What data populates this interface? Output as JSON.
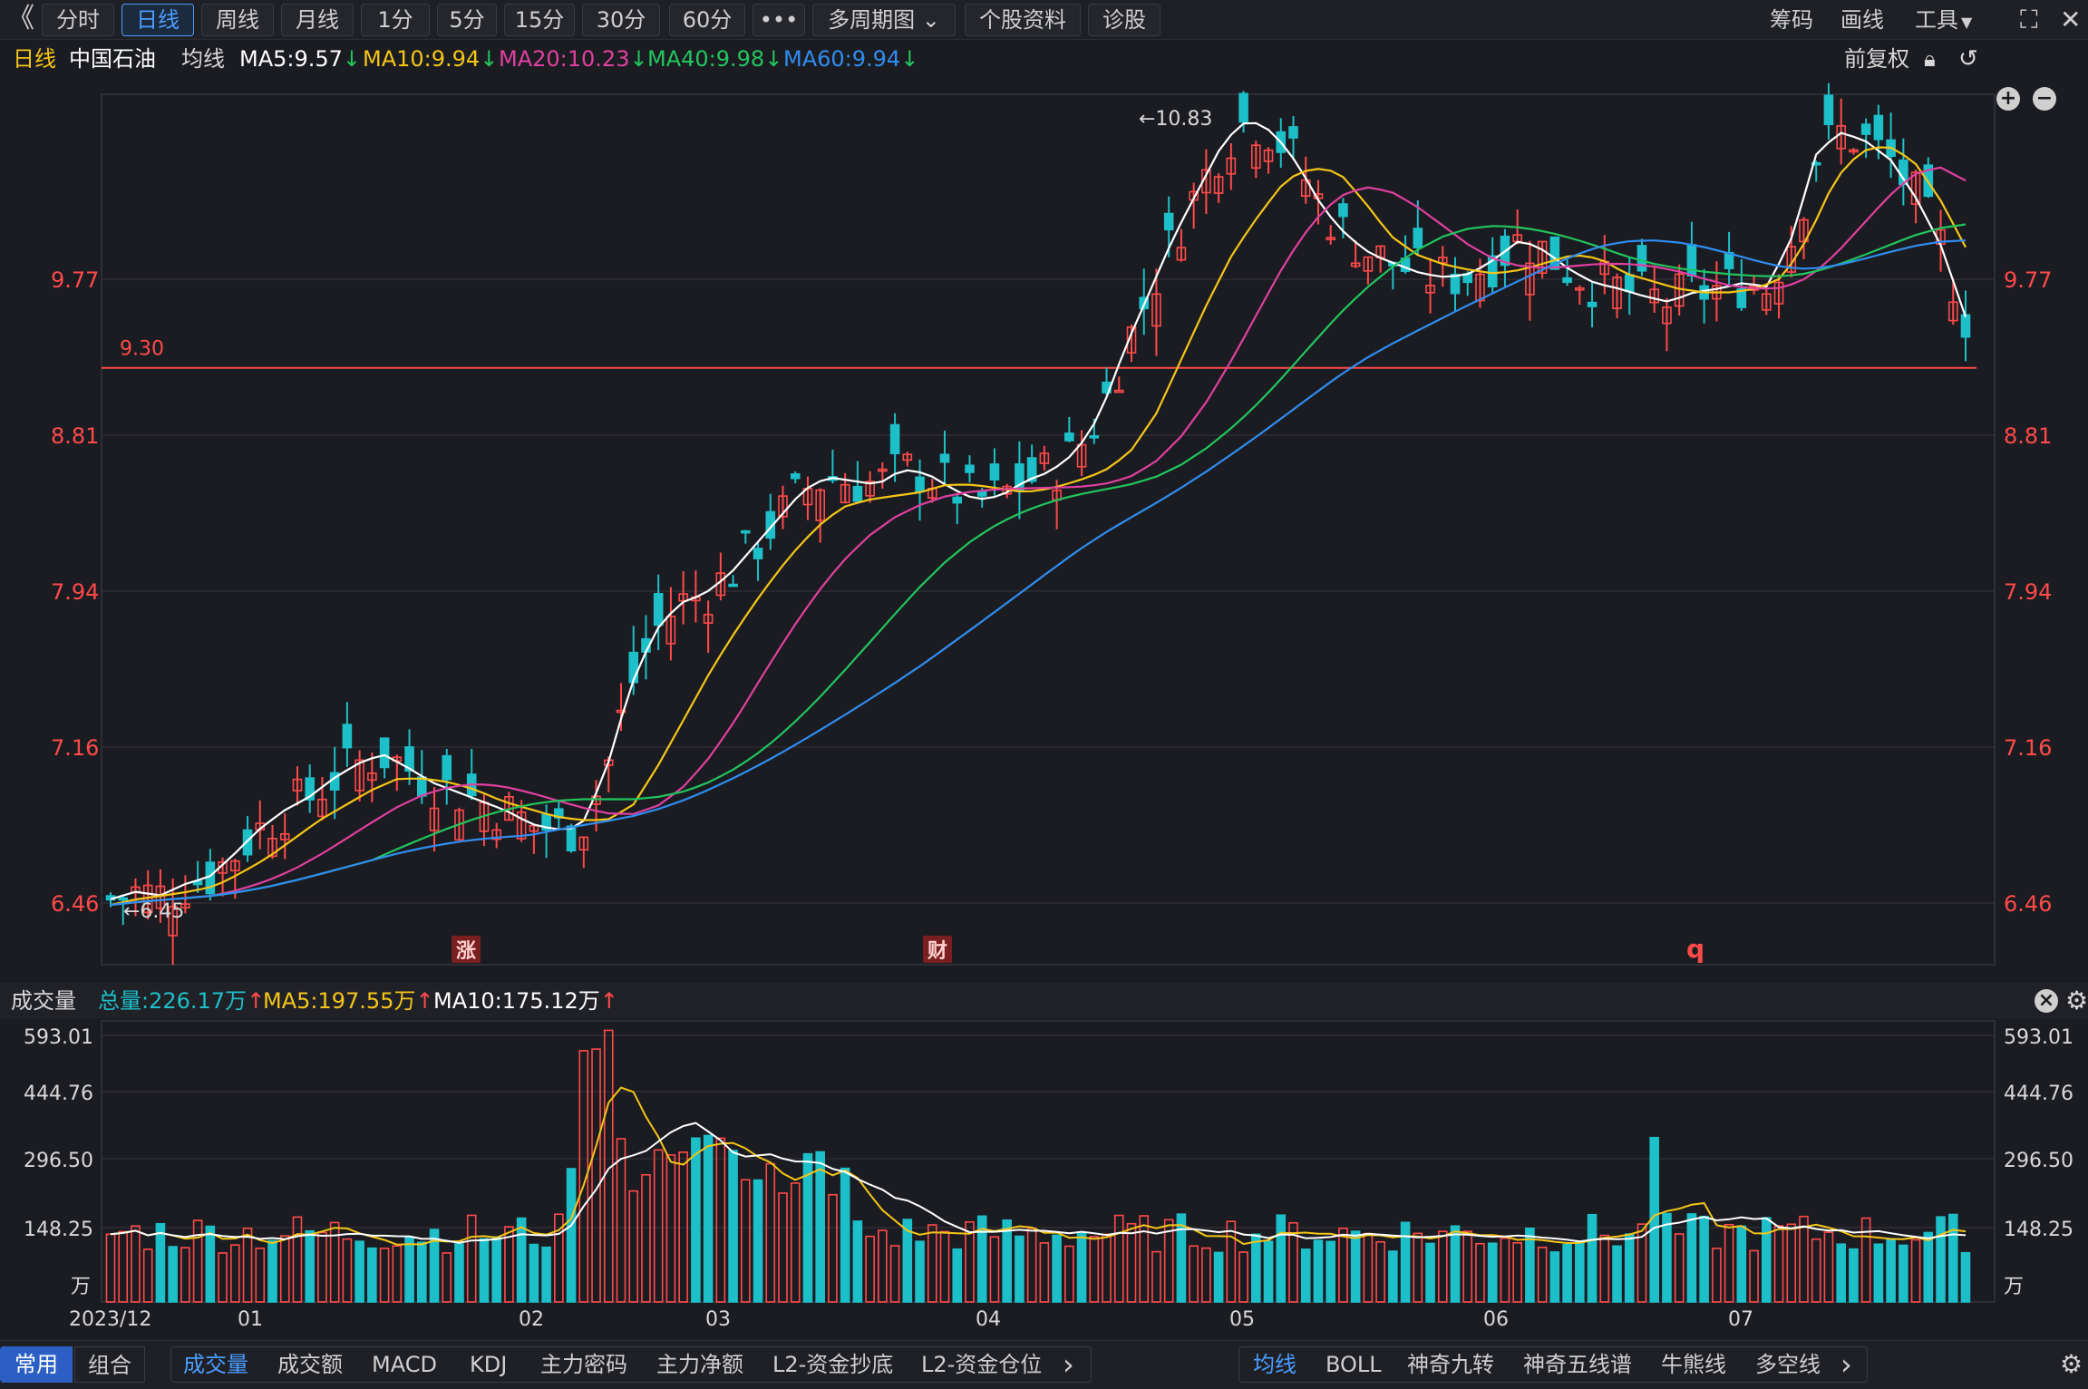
{
  "toolbar": {
    "back_glyph": "《",
    "tabs": [
      "分时",
      "日线",
      "周线",
      "月线",
      "1分",
      "5分",
      "15分",
      "30分",
      "60分",
      "•••",
      "多周期图",
      "个股资料",
      "诊股"
    ],
    "active_tab": 1,
    "right": [
      "筹码",
      "画线",
      "工具"
    ]
  },
  "info": {
    "period": "日线",
    "stock_name": "中国石油",
    "ma_label": "均线",
    "ma5": "MA5:9.57",
    "ma10": "MA10:9.94",
    "ma20": "MA20:10.23",
    "ma40": "MA40:9.98",
    "ma60": "MA60:9.94",
    "adjust": "前复权"
  },
  "colors": {
    "up": "#ff4a4a",
    "down": "#1dbfc9",
    "ma5": "#ffffff",
    "ma10": "#f5c518",
    "ma20": "#e040a0",
    "ma40": "#22c55e",
    "ma60": "#2f8df0",
    "blue": "#4a9dff"
  },
  "chart_data": {
    "type": "candlestick",
    "price_ticks": [
      "9.77",
      "8.81",
      "7.94",
      "7.16",
      "6.46"
    ],
    "high_label": "←10.83",
    "low_label": "←6.45",
    "ref_line": {
      "value": 9.3,
      "label": "9.30"
    },
    "markers": [
      "涨",
      "财",
      "q"
    ],
    "x_labels": [
      "2023/12",
      "01",
      "02",
      "03",
      "04",
      "05",
      "06",
      "07"
    ],
    "ma5_close": [
      6.48,
      6.52,
      6.5,
      6.56,
      6.6,
      6.72,
      6.85,
      6.95,
      7.02,
      7.12,
      7.2,
      7.25,
      7.18,
      7.1,
      7.05,
      7.0,
      6.95,
      6.88,
      6.85,
      6.86,
      7.15,
      7.6,
      7.9,
      8.05,
      8.1,
      8.2,
      8.35,
      8.5,
      8.65,
      8.72,
      8.7,
      8.68,
      8.76,
      8.74,
      8.66,
      8.6,
      8.62,
      8.7,
      8.75,
      8.85,
      9.05,
      9.4,
      9.7,
      10.0,
      10.25,
      10.5,
      10.62,
      10.55,
      10.38,
      10.15,
      10.0,
      9.9,
      9.85,
      9.8,
      9.78,
      9.8,
      9.88,
      9.98,
      9.92,
      9.82,
      9.75,
      9.72,
      9.68,
      9.65,
      9.7,
      9.72,
      9.75,
      9.73,
      10.0,
      10.45,
      10.55,
      10.5,
      10.4,
      10.2,
      9.95,
      9.57
    ],
    "ma10": [
      6.45,
      6.48,
      6.5,
      6.52,
      6.55,
      6.62,
      6.7,
      6.8,
      6.9,
      6.98,
      7.06,
      7.12,
      7.12,
      7.1,
      7.06,
      7.0,
      6.96,
      6.92,
      6.9,
      6.9,
      6.98,
      7.2,
      7.45,
      7.7,
      7.92,
      8.12,
      8.3,
      8.45,
      8.56,
      8.6,
      8.62,
      8.64,
      8.68,
      8.68,
      8.66,
      8.64,
      8.66,
      8.7,
      8.75,
      8.85,
      9.05,
      9.35,
      9.65,
      9.92,
      10.12,
      10.3,
      10.36,
      10.34,
      10.18,
      10.0,
      9.9,
      9.85,
      9.82,
      9.8,
      9.82,
      9.86,
      9.9,
      9.88,
      9.8,
      9.76,
      9.72,
      9.7,
      9.7,
      9.72,
      9.78,
      10.0,
      10.3,
      10.45,
      10.48,
      10.4,
      10.2,
      9.94
    ],
    "volume_ticks": [
      "593.01",
      "444.76",
      "296.50",
      "148.25"
    ],
    "volume_unit": "万"
  },
  "volume": {
    "label": "成交量",
    "total": "总量:226.17万",
    "ma5": "MA5:197.55万",
    "ma10": "MA10:175.12万"
  },
  "bottom": {
    "left_tabs": [
      "常用",
      "组合"
    ],
    "indicator_tabs": [
      "成交量",
      "成交额",
      "MACD",
      "KDJ",
      "主力密码",
      "主力净额",
      "L2-资金抄底",
      "L2-资金仓位"
    ],
    "overlay_tabs": [
      "均线",
      "BOLL",
      "神奇九转",
      "神奇五线谱",
      "牛熊线",
      "多空线"
    ],
    "more_glyph": "›"
  }
}
